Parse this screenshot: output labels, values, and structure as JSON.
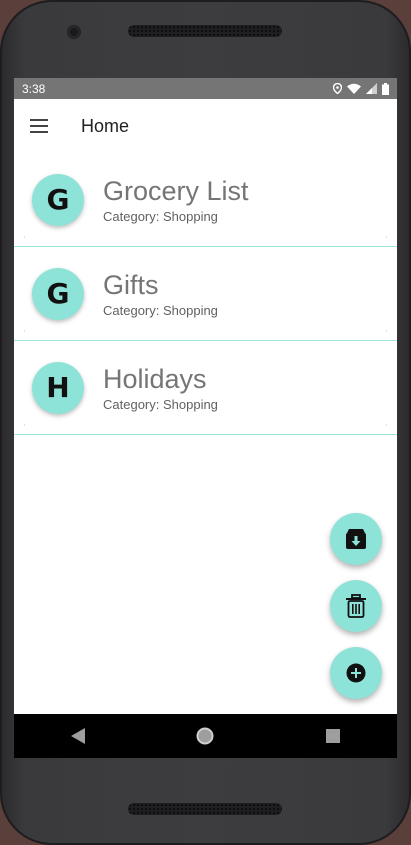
{
  "status": {
    "time": "3:38"
  },
  "appbar": {
    "title": "Home",
    "menu_icon": "menu-icon"
  },
  "lists": [
    {
      "initial": "G",
      "title": "Grocery List",
      "category": "Category: Shopping"
    },
    {
      "initial": "G",
      "title": "Gifts",
      "category": "Category: Shopping"
    },
    {
      "initial": "H",
      "title": "Holidays",
      "category": "Category: Shopping"
    }
  ],
  "fabs": [
    {
      "icon": "archive-icon"
    },
    {
      "icon": "trash-icon"
    },
    {
      "icon": "add-icon"
    }
  ],
  "colors": {
    "accent": "#8de3d7",
    "statusbar": "#757575",
    "divider": "#9ee5da"
  }
}
